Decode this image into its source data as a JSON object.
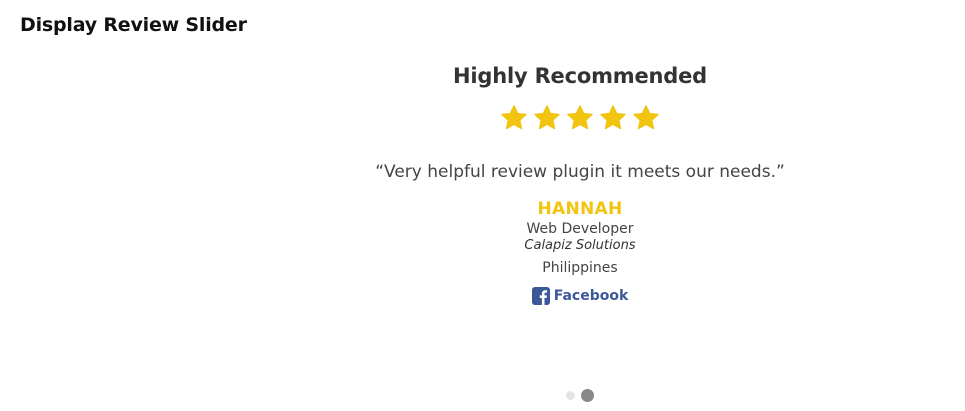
{
  "page": {
    "title": "Display Review Slider"
  },
  "review": {
    "title": "Highly Recommended",
    "rating": 5,
    "rating_max": 5,
    "quote": "“Very helpful review plugin it meets our needs.”",
    "author": {
      "name": "HANNAH",
      "role": "Web Developer",
      "company": "Calapiz Solutions",
      "country": "Philippines"
    },
    "social": {
      "label": "Facebook",
      "icon": "facebook-icon"
    }
  },
  "pagination": {
    "total": 2,
    "active_index": 1
  },
  "colors": {
    "star": "#f1c40f",
    "author_name": "#f1c40f",
    "facebook": "#3b5998",
    "dot_active": "#888888",
    "dot_inactive": "#e4e4e4"
  }
}
